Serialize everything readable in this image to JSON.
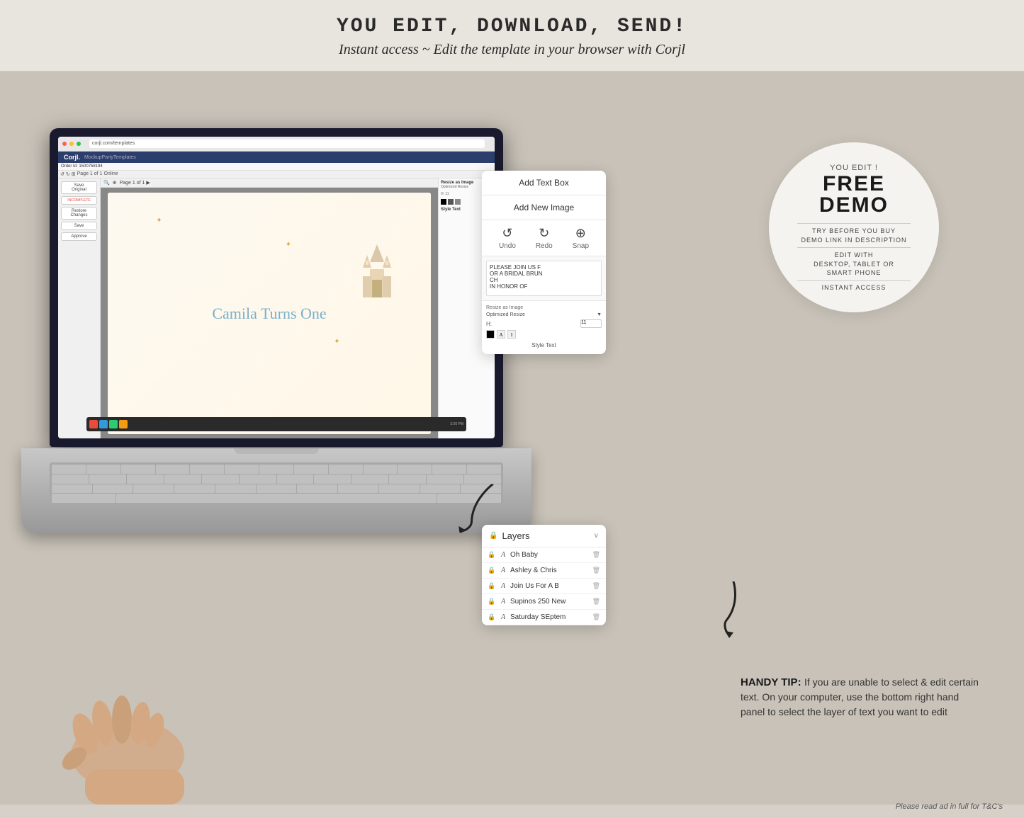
{
  "header": {
    "main_title": "YOU EDIT, DOWNLOAD, SEND!",
    "sub_title": "Instant access ~ Edit the template in your browser with Corjl"
  },
  "laptop": {
    "browser_url": "corjl.com/templates",
    "order_id": "Order Id: 1500758194",
    "canvas_text": "Camila Turns One",
    "incomplete_label": "INCOMPLETE"
  },
  "floating_panel": {
    "btn1": "Add Text Box",
    "btn2": "Add New Image",
    "undo": "Undo",
    "redo": "Redo",
    "snap": "Snap",
    "text_content": "PLEASE JOIN US F\nOR A BRIDAL BRUN\nCH\nIN HONOR OF",
    "style_label": "Style Text"
  },
  "layers_panel": {
    "title": "Layers",
    "items": [
      {
        "name": "Oh Baby"
      },
      {
        "name": "Ashley & Chris"
      },
      {
        "name": "Join Us For A B"
      },
      {
        "name": "Supinos 250 New"
      },
      {
        "name": "Saturday SEptem"
      }
    ]
  },
  "demo_circle": {
    "you_edit": "YOU EDIT !",
    "free": "FREE",
    "demo": "DEMO",
    "line1": "TRY BEFORE YOU BUY",
    "line2": "DEMO LINK IN DESCRIPTION",
    "edit_with": "EDIT WITH",
    "devices": "DESKTOP, TABLET OR",
    "smartphone": "SMART PHONE",
    "instant": "INSTANT ACCESS"
  },
  "handy_tip": {
    "bold": "HANDY TIP:",
    "text": "If you are unable to select & edit certain text. On your computer, use the bottom right hand panel to select the layer of text you want to edit"
  },
  "arrows": {
    "down": "↙",
    "curve": "↙"
  },
  "footer": {
    "text": "Please read ad in full for T&C's"
  }
}
